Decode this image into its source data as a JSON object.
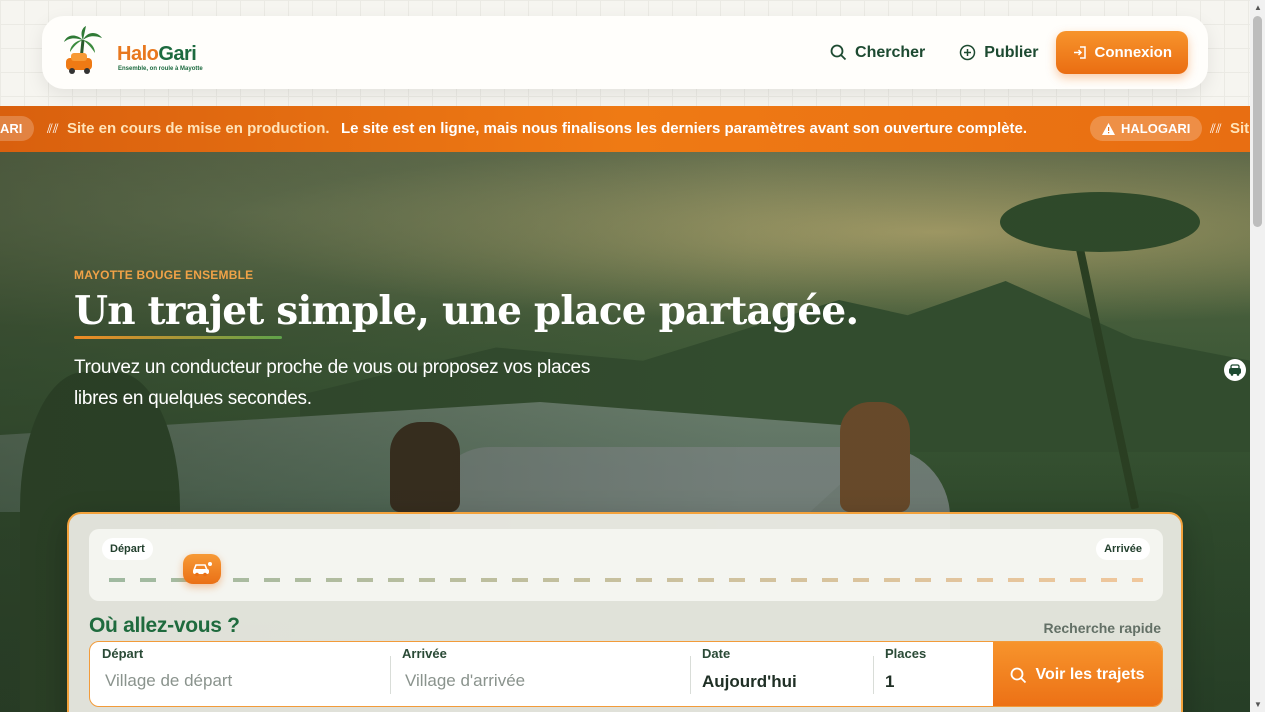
{
  "header": {
    "logo": {
      "name_a": "Halo",
      "name_b": "Gari",
      "tagline": "Ensemble, on roule à Mayotte"
    },
    "nav": {
      "search_label": "Chercher",
      "publish_label": "Publier",
      "login_label": "Connexion"
    }
  },
  "ticker": {
    "badge_left": "ARI",
    "strong": "Site en cours de mise en production.",
    "text": "Le site est en ligne, mais nous finalisons les derniers paramètres avant son ouverture complète.",
    "badge_right": "HALOGARI",
    "strong_cut": "Sit"
  },
  "hero": {
    "kicker": "MAYOTTE BOUGE ENSEMBLE",
    "title": "Un trajet simple, une place partagée.",
    "subtitle": "Trouvez un conducteur proche de vous ou proposez vos places libres en quelques secondes."
  },
  "search": {
    "route_start": "Départ",
    "route_end": "Arrivée",
    "title": "Où allez-vous ?",
    "quick_label": "Recherche rapide",
    "fields": {
      "depart_label": "Départ",
      "depart_placeholder": "Village de départ",
      "arrivee_label": "Arrivée",
      "arrivee_placeholder": "Village d'arrivée",
      "date_label": "Date",
      "date_value": "Aujourd'hui",
      "places_label": "Places",
      "places_value": "1"
    },
    "submit_label": "Voir les trajets"
  },
  "colors": {
    "accent": "#ef7a14",
    "brand_green": "#1f6b3e"
  },
  "icons": [
    "logo-palm-car-icon",
    "search-icon",
    "plus-circle-icon",
    "login-icon",
    "warning-icon",
    "ticker-stripes-icon",
    "car-icon",
    "side-widget-icon"
  ]
}
